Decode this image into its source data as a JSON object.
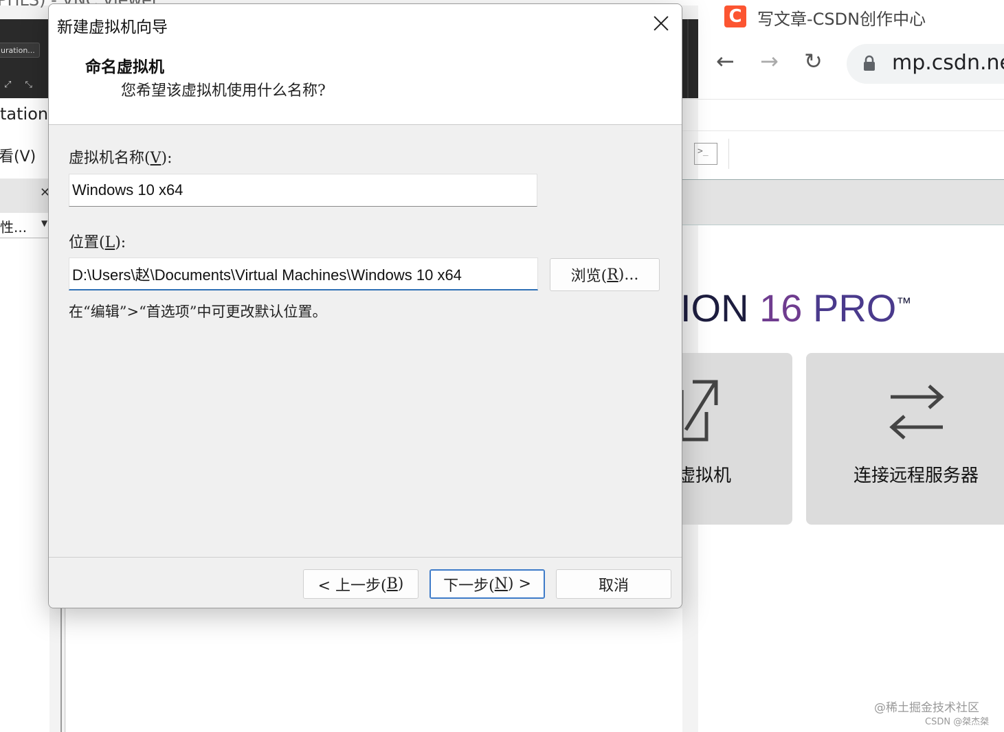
{
  "background": {
    "vnc_title": "PHLS) - VNC Viewer",
    "vnc_config_button": "uration...",
    "left_partial_title": "tation",
    "left_partial_menu": "看(V)",
    "left_combo_text": "性...",
    "browser_tab_title": "写文章-CSDN创作中心",
    "browser_address": "mp.csdn.net",
    "brand": {
      "ion": "ION",
      "version": "16",
      "pro": "PRO",
      "tm": "™"
    },
    "cards": [
      {
        "label": "虚拟机",
        "icon": "open-external-icon"
      },
      {
        "label": "连接远程服务器",
        "icon": "swap-arrows-icon"
      }
    ],
    "watermark_line1": "@稀土掘金技术社区",
    "watermark_line2": "CSDN @桀杰桀"
  },
  "dialog": {
    "title": "新建虚拟机向导",
    "heading": "命名虚拟机",
    "subheading": "您希望该虚拟机使用什么名称?",
    "name_label_prefix": "虚拟机名称(",
    "name_label_key": "V",
    "name_label_suffix": "):",
    "name_value": "Windows 10 x64",
    "location_label_prefix": "位置(",
    "location_label_key": "L",
    "location_label_suffix": "):",
    "location_value": "D:\\Users\\赵\\Documents\\Virtual Machines\\Windows 10 x64",
    "browse_prefix": "浏览(",
    "browse_key": "R",
    "browse_suffix": ")...",
    "hint": "在“编辑”>“首选项”中可更改默认位置。",
    "back_prefix": "< 上一步(",
    "back_key": "B",
    "back_suffix": ")",
    "next_prefix": "下一步(",
    "next_key": "N",
    "next_suffix": ") >",
    "cancel": "取消"
  },
  "colors": {
    "csdn_red": "#fc5531",
    "focus_blue": "#2e6fb5",
    "brand_purple": "#6f3c8f"
  }
}
